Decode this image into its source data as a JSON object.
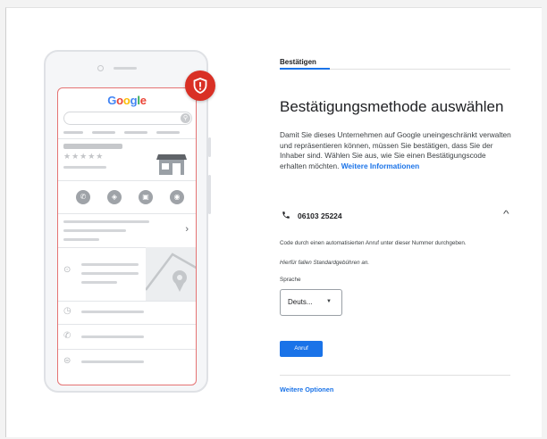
{
  "illustration": {
    "logo": [
      "G",
      "o",
      "o",
      "g",
      "l",
      "e"
    ],
    "logo_colors": [
      "#4285f4",
      "#ea4335",
      "#fbbc05",
      "#4285f4",
      "#34a853",
      "#ea4335"
    ],
    "badge_icon": "shield-alert-icon",
    "accent": "#d93025"
  },
  "verify": {
    "tab_label": "Bestätigen",
    "title": "Bestätigungsmethode auswählen",
    "description": "Damit Sie dieses Unternehmen auf Google uneingeschränkt verwalten und repräsentieren können, müssen Sie bestätigen, dass Sie der Inhaber sind. Wählen Sie aus, wie Sie einen Bestätigungscode erhalten möchten.",
    "more_info_link": "Weitere Informationen",
    "phone_icon": "phone-icon",
    "phone_number": "06103 25224",
    "code_info": "Code durch einen automatisierten Anruf unter dieser Nummer durchgeben.",
    "fee_note": "Hierfür fallen Standardgebühren an.",
    "language_label": "Sprache",
    "language_value": "Deuts...",
    "call_button": "Anruf",
    "more_options": "Weitere Optionen",
    "accent_color": "#1a73e8"
  }
}
